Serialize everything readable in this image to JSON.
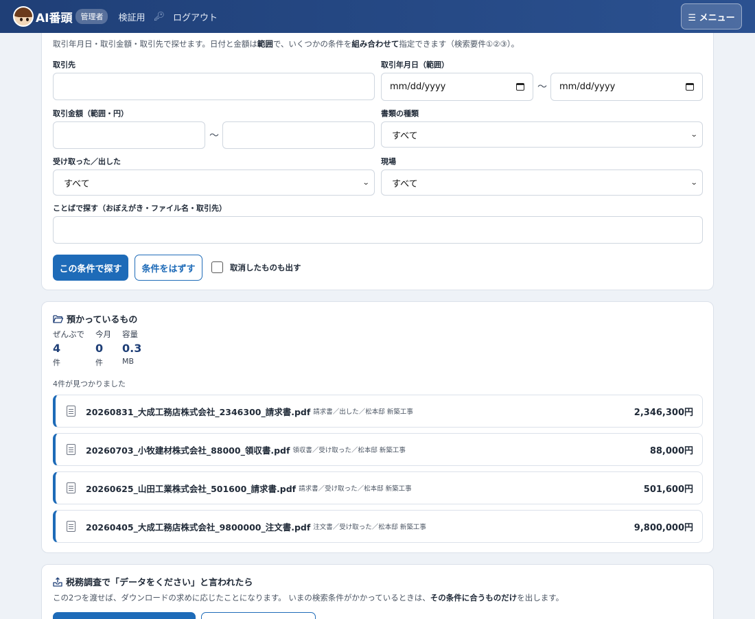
{
  "nav": {
    "brand": "AI番頭",
    "role_badge": "管理者",
    "link_verify": "検証用",
    "link_logout": "ログアウト",
    "menu_label": "☰ メニュー"
  },
  "search": {
    "intro_a": "取引年月日・取引金額・取引先で探せます。日付と金額は",
    "intro_b": "範囲",
    "intro_c": "で、いくつかの条件を",
    "intro_d": "組み合わせて",
    "intro_e": "指定できます（検索要件①②③）。",
    "partner_label": "取引先",
    "partner_value": "",
    "date_label": "取引年月日（範囲）",
    "date_from_placeholder": "mm/dd/yyyy",
    "date_to_placeholder": "mm/dd/yyyy",
    "range_sep": "～",
    "amount_label": "取引金額（範囲・円）",
    "amount_from": "",
    "amount_to": "",
    "doctype_label": "書類の種類",
    "doctype_value": "すべて",
    "direction_label": "受け取った／出した",
    "direction_value": "すべて",
    "site_label": "現場",
    "site_value": "すべて",
    "keyword_label": "ことばで探す（おぼえがき・ファイル名・取引先）",
    "keyword_value": "",
    "search_button": "この条件で探す",
    "clear_button": "条件をはずす",
    "include_cancelled_label": "取消したものも出す",
    "include_cancelled_checked": false
  },
  "storage": {
    "title": "預かっているもの",
    "stats": [
      {
        "label": "ぜんぶで",
        "value": "4",
        "unit": "件"
      },
      {
        "label": "今月",
        "value": "0",
        "unit": "件"
      },
      {
        "label": "容量",
        "value": "0.3",
        "unit": "MB"
      }
    ],
    "found_text": "4件が見つかりました",
    "files": [
      {
        "name": "20260831_大成工務店株式会社_2346300_請求書.pdf",
        "meta": "請求書／出した／松本邸 新築工事",
        "amount": "2,346,300円"
      },
      {
        "name": "20260703_小牧建材株式会社_88000_領収書.pdf",
        "meta": "領収書／受け取った／松本邸 新築工事",
        "amount": "88,000円"
      },
      {
        "name": "20260625_山田工業株式会社_501600_請求書.pdf",
        "meta": "請求書／受け取った／松本邸 新築工事",
        "amount": "501,600円"
      },
      {
        "name": "20260405_大成工務店株式会社_9800000_注文書.pdf",
        "meta": "注文書／受け取った／松本邸 新築工事",
        "amount": "9,800,000円"
      }
    ]
  },
  "tax": {
    "title": "税務調査で「データをください」と言われたら",
    "desc_a": "この2つを渡せば、ダウンロードの求めに応じたことになります。 いまの検索条件がかかっているときは、",
    "desc_b": "その条件に合うものだけ",
    "desc_c": "を出します。"
  },
  "colors": {
    "primary": "#1e6bb8",
    "nav": "#1f3f77"
  }
}
